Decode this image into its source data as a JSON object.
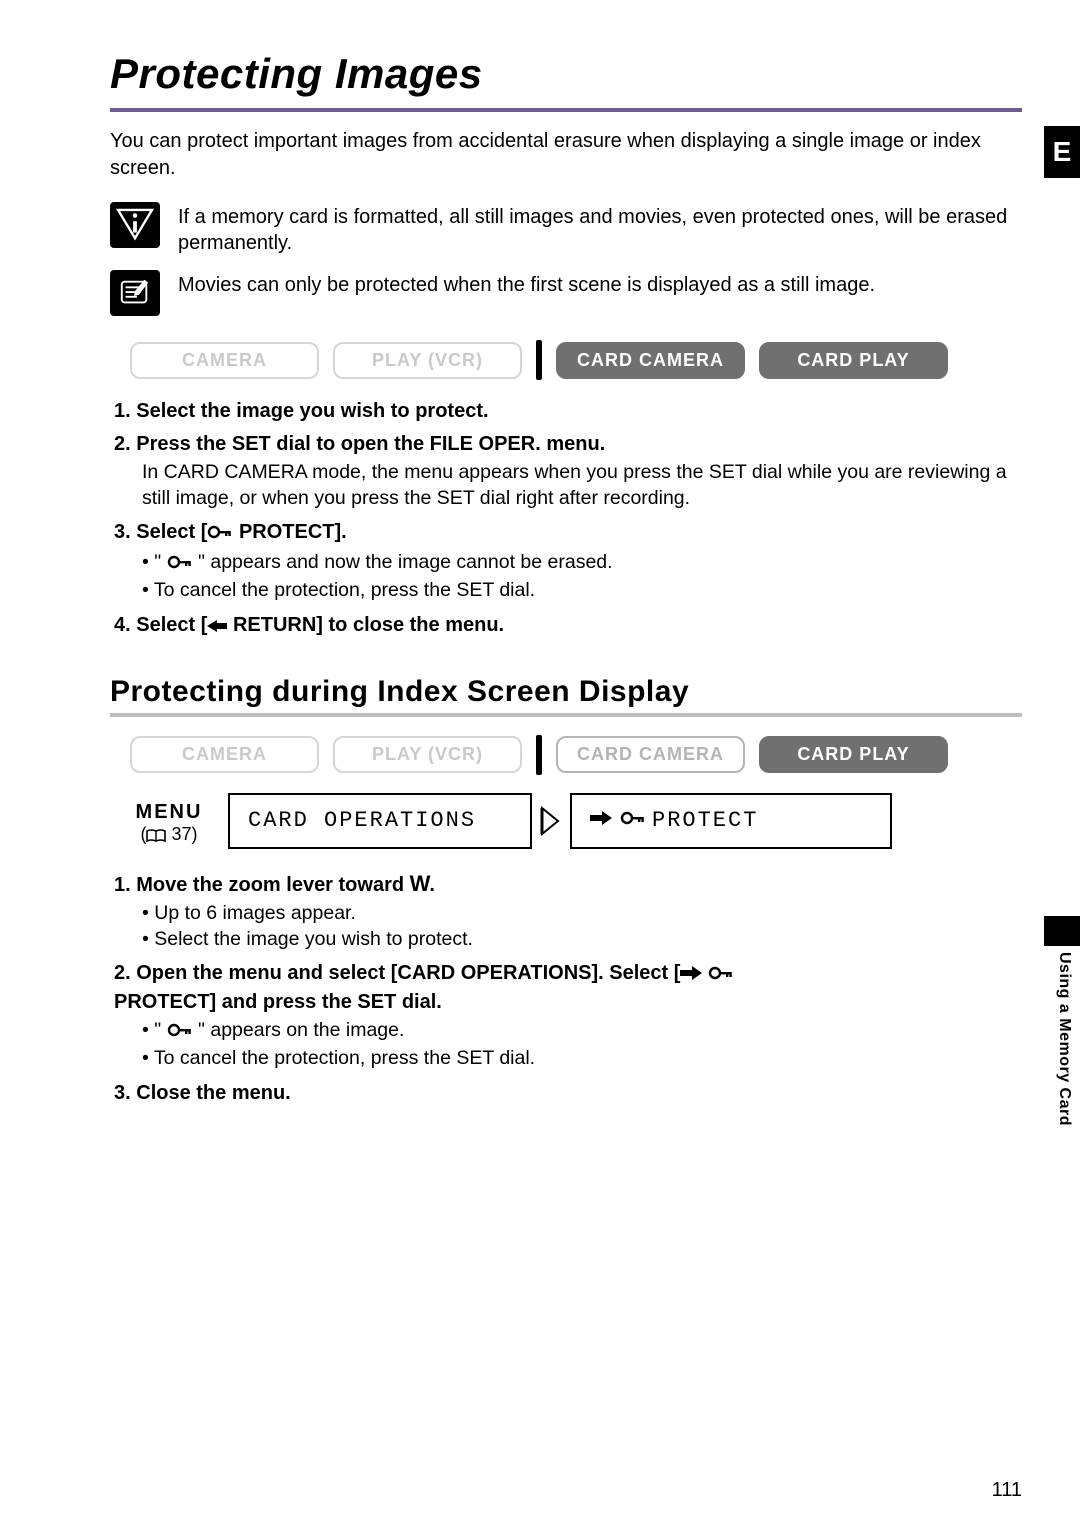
{
  "title": "Protecting Images",
  "intro": "You can protect important images from accidental erasure when displaying a single image or index screen.",
  "warning_note": "If a memory card is formatted, all still images and movies, even protected ones, will be erased permanently.",
  "info_note": "Movies can only be protected when the first scene is displayed as a still image.",
  "modes1": {
    "camera": "CAMERA",
    "playvcr": "PLAY (VCR)",
    "cardcamera": "CARD CAMERA",
    "cardplay": "CARD PLAY"
  },
  "section1_steps": {
    "s1": "Select the image you wish to protect.",
    "s2": "Press the SET dial to open the FILE OPER. menu.",
    "s2_body": "In CARD CAMERA mode, the menu appears when you press the SET dial while you are reviewing a still image, or when you press the SET dial right after recording.",
    "s3_pre": "Select [",
    "s3_post": " PROTECT].",
    "s3_b1_pre": "\" ",
    "s3_b1_post": " \" appears and now the image cannot be erased.",
    "s3_b2": "To cancel the protection, press the SET dial.",
    "s4_pre": "Select [",
    "s4_mid": "  RETURN] to close the menu."
  },
  "subheading": "Protecting during Index Screen Display",
  "modes2": {
    "camera": "CAMERA",
    "playvcr": "PLAY (VCR)",
    "cardcamera": "CARD CAMERA",
    "cardplay": "CARD PLAY"
  },
  "menu_label": "MENU",
  "menu_ref": "37",
  "menu_box_left": "CARD OPERATIONS",
  "menu_box_right": "PROTECT",
  "section2_steps": {
    "s1_pre": "Move the zoom lever toward ",
    "s1_mark": "W",
    "s1_post": ".",
    "s1_b1": "Up to 6 images appear.",
    "s1_b2": "Select the image you wish to protect.",
    "s2_line1_pre": "Open the menu and select [CARD OPERATIONS]. Select [",
    "s2_line2": "PROTECT] and press the SET dial.",
    "s2_b1_pre": "\" ",
    "s2_b1_post": " \" appears on the image.",
    "s2_b2": "To cancel the protection, press the SET dial.",
    "s3": "Close the menu."
  },
  "side_e": "E",
  "side_section": "Using a Memory Card",
  "page_number": "111"
}
